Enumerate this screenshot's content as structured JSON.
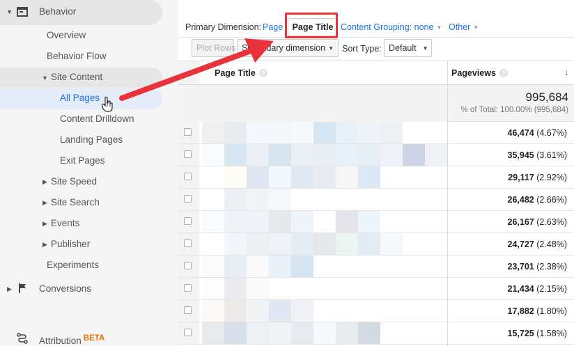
{
  "sidebar": {
    "behavior": "Behavior",
    "overview": "Overview",
    "behavior_flow": "Behavior Flow",
    "site_content": "Site Content",
    "all_pages": "All Pages",
    "content_drilldown": "Content Drilldown",
    "landing_pages": "Landing Pages",
    "exit_pages": "Exit Pages",
    "site_speed": "Site Speed",
    "site_search": "Site Search",
    "events": "Events",
    "publisher": "Publisher",
    "experiments": "Experiments",
    "conversions": "Conversions",
    "attribution": "Attribution",
    "beta": "BETA"
  },
  "dimensions": {
    "label": "Primary Dimension:",
    "page": "Page",
    "page_title": "Page Title",
    "content_grouping": "Content Grouping: none",
    "other": "Other"
  },
  "toolbar": {
    "plot_rows": "Plot Rows",
    "secondary_dimension": "Secondary dimension",
    "sort_type_label": "Sort Type:",
    "sort_type_value": "Default"
  },
  "table": {
    "col_title": "Page Title",
    "col_pageviews": "Pageviews",
    "total": "995,684",
    "total_sub": "% of Total: 100.00% (995,684)",
    "rows": [
      {
        "value": "46,474",
        "pct": "(4.67%)"
      },
      {
        "value": "35,945",
        "pct": "(3.61%)"
      },
      {
        "value": "29,117",
        "pct": "(2.92%)"
      },
      {
        "value": "26,482",
        "pct": "(2.66%)"
      },
      {
        "value": "26,167",
        "pct": "(2.63%)"
      },
      {
        "value": "24,727",
        "pct": "(2.48%)"
      },
      {
        "value": "23,701",
        "pct": "(2.38%)"
      },
      {
        "value": "21,434",
        "pct": "(2.15%)"
      },
      {
        "value": "17,882",
        "pct": "(1.80%)"
      },
      {
        "value": "15,725",
        "pct": "(1.58%)"
      }
    ]
  },
  "colors": {
    "accent": "#1a73e8",
    "highlight": "#e8333a",
    "beta": "#e8710a"
  }
}
